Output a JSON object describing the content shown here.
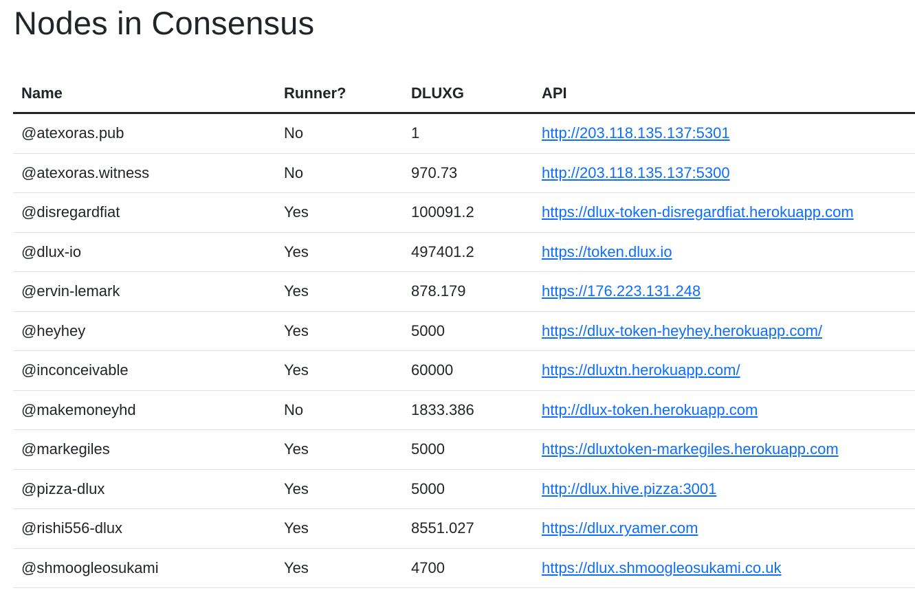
{
  "page_title": "Nodes in Consensus",
  "table": {
    "headers": {
      "name": "Name",
      "runner": "Runner?",
      "dluxg": "DLUXG",
      "api": "API"
    },
    "rows": [
      {
        "name": "@atexoras.pub",
        "runner": "No",
        "dluxg": "1",
        "api": "http://203.118.135.137:5301"
      },
      {
        "name": "@atexoras.witness",
        "runner": "No",
        "dluxg": "970.73",
        "api": "http://203.118.135.137:5300"
      },
      {
        "name": "@disregardfiat",
        "runner": "Yes",
        "dluxg": "100091.2",
        "api": "https://dlux-token-disregardfiat.herokuapp.com"
      },
      {
        "name": "@dlux-io",
        "runner": "Yes",
        "dluxg": "497401.2",
        "api": "https://token.dlux.io"
      },
      {
        "name": "@ervin-lemark",
        "runner": "Yes",
        "dluxg": "878.179",
        "api": "https://176.223.131.248"
      },
      {
        "name": "@heyhey",
        "runner": "Yes",
        "dluxg": "5000",
        "api": "https://dlux-token-heyhey.herokuapp.com/"
      },
      {
        "name": "@inconceivable",
        "runner": "Yes",
        "dluxg": "60000",
        "api": "https://dluxtn.herokuapp.com/"
      },
      {
        "name": "@makemoneyhd",
        "runner": "No",
        "dluxg": "1833.386",
        "api": "http://dlux-token.herokuapp.com"
      },
      {
        "name": "@markegiles",
        "runner": "Yes",
        "dluxg": "5000",
        "api": "https://dluxtoken-markegiles.herokuapp.com"
      },
      {
        "name": "@pizza-dlux",
        "runner": "Yes",
        "dluxg": "5000",
        "api": "http://dlux.hive.pizza:3001"
      },
      {
        "name": "@rishi556-dlux",
        "runner": "Yes",
        "dluxg": "8551.027",
        "api": "https://dlux.ryamer.com"
      },
      {
        "name": "@shmoogleosukami",
        "runner": "Yes",
        "dluxg": "4700",
        "api": "https://dlux.shmoogleosukami.co.uk"
      }
    ]
  },
  "colors": {
    "text": "#212529",
    "link": "#0d6efd",
    "row_border": "#dee2e6"
  }
}
